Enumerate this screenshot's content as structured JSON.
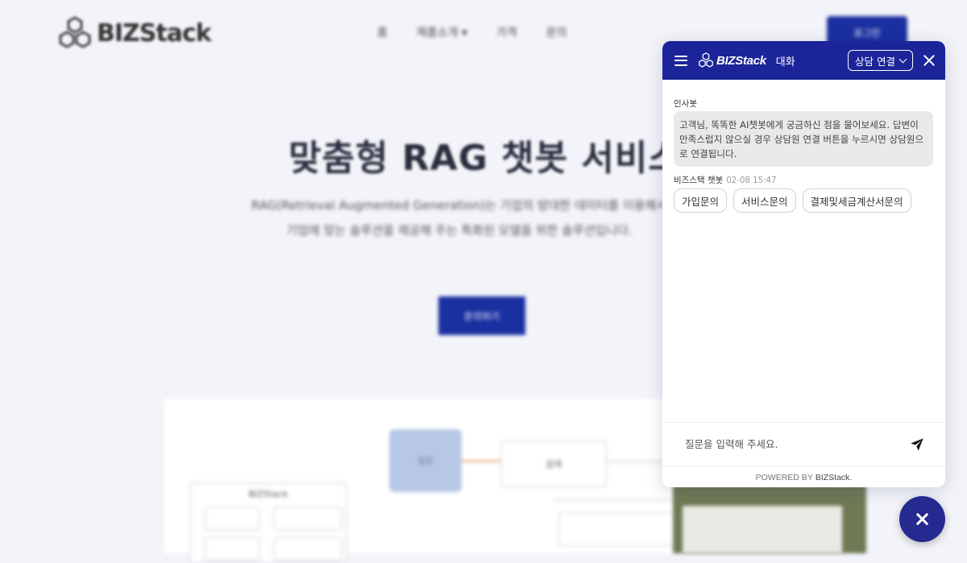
{
  "page": {
    "logo_text": "BIZStack",
    "nav": [
      "홈",
      "제품소개 ▾",
      "가격",
      "문의"
    ],
    "top_button": "로그인",
    "hero_title": "맞춤형 RAG 챗봇 서비스",
    "hero_desc": "RAG(Retrieval Augmented Generation)는 기업의 방대한 데이터를 이용해서 기업에 맞는 솔루션을 제공해 주는 특화된 모델을 위한 솔루션입니다.",
    "hero_button": "문의하기",
    "diagram_labels": {
      "blue_box": "질문",
      "box_top": "검색",
      "left_panel_title": "BIZStack"
    }
  },
  "chat": {
    "header": {
      "brand": "BIZStack",
      "title": "대화",
      "consult_label": "상담 연결"
    },
    "messages": [
      {
        "sender": "인사봇",
        "text": "고객님, 똑똑한 AI챗봇에게 궁금하신 점을 물어보세요. 답변이 만족스럽지 않으실 경우 상담원 연결 버튼을 누르시면 상담원으로 연결됩니다."
      },
      {
        "sender": "비즈스택 챗봇",
        "time": "02-08 15:47",
        "quick_replies": [
          "가입문의",
          "서비스문의",
          "결제및세금계산서문의"
        ]
      }
    ],
    "input": {
      "placeholder": "질문을 입력해 주세요.",
      "value": ""
    },
    "powered_prefix": "POWERED BY",
    "powered_brand": "BIZStack."
  },
  "icons": {
    "menu": "hamburger-icon",
    "logo": "bizstack-logo-icon",
    "chevron": "chevron-down-icon",
    "close": "close-icon",
    "send": "send-icon",
    "fab": "close-icon"
  },
  "colors": {
    "header_bg": "#1b2599",
    "bubble_bg": "#e9e9ec",
    "fab_bg": "#242a8f",
    "page_bg": "#f3f4f9"
  }
}
